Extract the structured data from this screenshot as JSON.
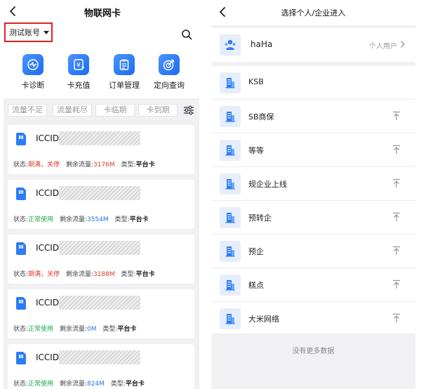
{
  "left": {
    "title": "物联网卡",
    "account_label": "测试账号",
    "functions": [
      {
        "label": "卡诊断",
        "icon": "card-diagnose-icon"
      },
      {
        "label": "卡充值",
        "icon": "card-recharge-icon"
      },
      {
        "label": "订单管理",
        "icon": "order-clipboard-icon"
      },
      {
        "label": "定向查询",
        "icon": "target-query-icon"
      }
    ],
    "filters": [
      "流量不足",
      "流量耗尽",
      "卡临期",
      "卡到期"
    ],
    "cards": [
      {
        "iccid_label": "ICCID:",
        "status_label": "状态:",
        "status": "期满，关停",
        "status_color": "red",
        "flow_label": "剩余流量:",
        "flow": "3176M",
        "flow_color": "red",
        "type_label": "类型:",
        "type": "平台卡"
      },
      {
        "iccid_label": "ICCID:",
        "status_label": "状态:",
        "status": "正常使用",
        "status_color": "green",
        "flow_label": "剩余流量:",
        "flow": "3554M",
        "flow_color": "blue",
        "type_label": "类型:",
        "type": "平台卡"
      },
      {
        "iccid_label": "ICCID:",
        "status_label": "状态:",
        "status": "期满，关停",
        "status_color": "red",
        "flow_label": "剩余流量:",
        "flow": "3188M",
        "flow_color": "red",
        "type_label": "类型:",
        "type": "平台卡"
      },
      {
        "iccid_label": "ICCID:",
        "status_label": "状态:",
        "status": "正常使用",
        "status_color": "green",
        "flow_label": "剩余流量:",
        "flow": "0M",
        "flow_color": "blue",
        "type_label": "类型:",
        "type": "平台卡"
      },
      {
        "iccid_label": "ICCID:",
        "status_label": "状态:",
        "status": "正常使用",
        "status_color": "green",
        "flow_label": "剩余流量:",
        "flow": "824M",
        "flow_color": "blue",
        "type_label": "类型:",
        "type": "平台卡"
      }
    ]
  },
  "right": {
    "title": "选择个人/企业进入",
    "user": {
      "name": "haHa",
      "type": "个人用户"
    },
    "companies": [
      {
        "name": "KSB",
        "pin": false
      },
      {
        "name": "SB商保",
        "pin": true
      },
      {
        "name": "等等",
        "pin": true
      },
      {
        "name": "规企业上线",
        "pin": true
      },
      {
        "name": "预转企",
        "pin": true
      },
      {
        "name": "预企",
        "pin": true
      },
      {
        "name": "糕点",
        "pin": true
      },
      {
        "name": "大米网络",
        "pin": true
      }
    ],
    "no_more": "没有更多数据"
  },
  "colors": {
    "red": "#e0362b",
    "green": "#1fa84a",
    "blue": "#2277e6",
    "accent": "#1d6cf0",
    "highlight_border": "#e02020"
  }
}
